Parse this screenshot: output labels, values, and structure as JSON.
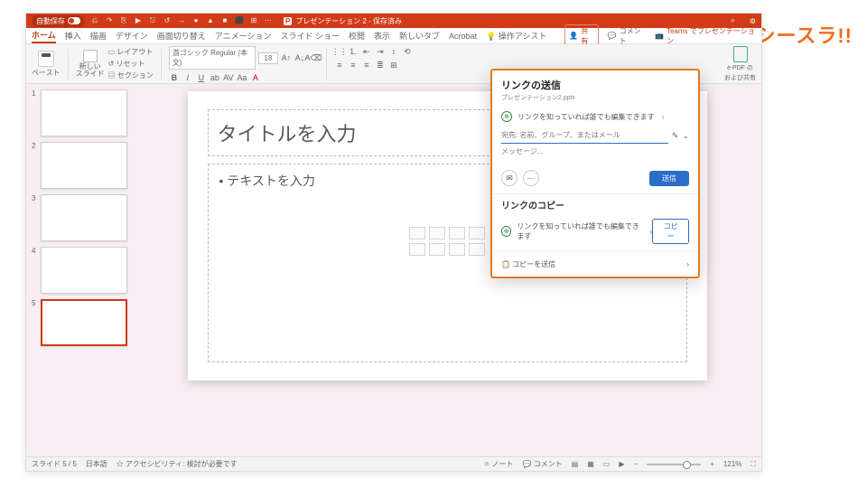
{
  "brand": "シースラ!!",
  "titlebar": {
    "autosave": "自動保存",
    "doc_icon": "P",
    "title": "プレゼンテーション 2 - 保存済み",
    "icons": [
      "⎌",
      "↷",
      "⎘",
      "▶",
      "⎋",
      "↺",
      "→",
      "●",
      "▲",
      "■",
      "⬛",
      "⊞",
      "⋯"
    ]
  },
  "tabs": {
    "home": "ホーム",
    "insert": "挿入",
    "draw": "描画",
    "design": "デザイン",
    "trans": "画面切り替え",
    "anim": "アニメーション",
    "ss": "スライド ショー",
    "review": "校閲",
    "view": "表示",
    "newtab": "新しいタブ",
    "acrobat": "Acrobat",
    "tell": "操作アシスト",
    "share": "共有",
    "comment": "コメント",
    "teams": "Teams でプレゼンテーション"
  },
  "ribbon": {
    "paste": "ペースト",
    "newslide": "新しい\nスライド",
    "layout": "レイアウト",
    "reset": "リセット",
    "section": "セクション",
    "font": "游ゴシック Regular (本文)",
    "size": "18",
    "pdf1": "e PDF の",
    "pdf2": "および共有"
  },
  "slide": {
    "title_ph": "タイトルを入力",
    "body_ph": "• テキストを入力"
  },
  "popover": {
    "title": "リンクの送信",
    "filename": "プレゼンテーション2.pptx",
    "perm": "リンクを知っていれば誰でも編集できます",
    "to_ph": "宛先: 名前、グループ、またはメール",
    "msg_ph": "メッセージ...",
    "send": "送信",
    "copy_title": "リンクのコピー",
    "copy_btn": "コピー",
    "foot": "コピーを送信"
  },
  "status": {
    "slide": "スライド 5 / 5",
    "lang": "日本語",
    "acc": "アクセシビリティ: 検討が必要です",
    "notes": "ノート",
    "comments": "コメント",
    "zoom": "121%"
  },
  "thumbs": [
    1,
    2,
    3,
    4,
    5
  ]
}
